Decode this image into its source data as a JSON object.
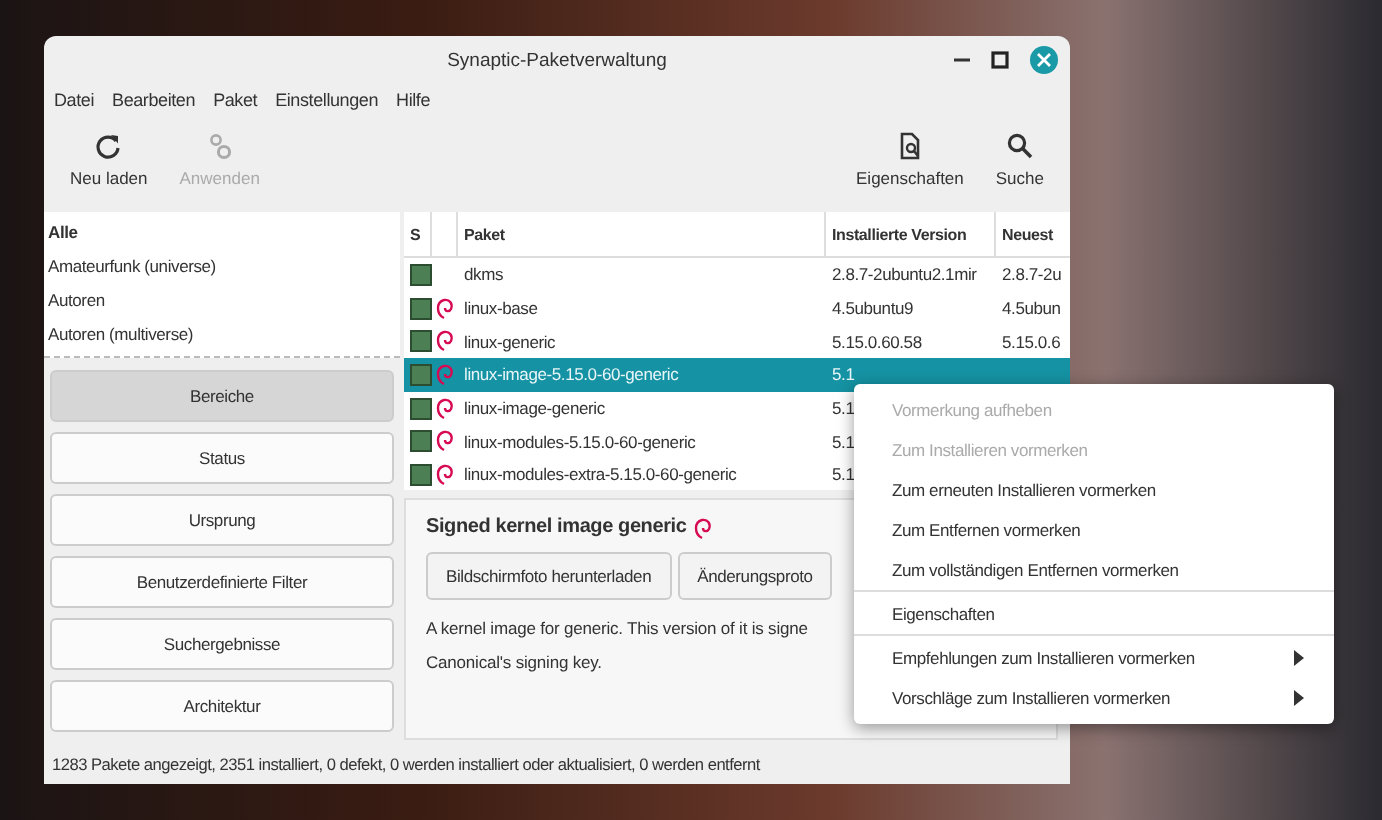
{
  "window": {
    "title": "Synaptic-Paketverwaltung"
  },
  "menu_bar": [
    "Datei",
    "Bearbeiten",
    "Paket",
    "Einstellungen",
    "Hilfe"
  ],
  "toolbar": [
    {
      "label": "Neu laden",
      "kind": "reload",
      "disabled": false
    },
    {
      "label": "Anwenden",
      "kind": "apply",
      "disabled": true
    },
    {
      "label": "Eigenschaften",
      "kind": "properties",
      "disabled": false
    },
    {
      "label": "Suche",
      "kind": "search",
      "disabled": false
    }
  ],
  "sections": [
    {
      "label": "Alle",
      "selected": true
    },
    {
      "label": "Amateurfunk (universe)",
      "selected": false
    },
    {
      "label": "Autoren",
      "selected": false
    },
    {
      "label": "Autoren (multiverse)",
      "selected": false
    }
  ],
  "filter_buttons": [
    {
      "label": "Bereiche",
      "selected": true
    },
    {
      "label": "Status",
      "selected": false
    },
    {
      "label": "Ursprung",
      "selected": false
    },
    {
      "label": "Benutzerdefinierte Filter",
      "selected": false
    },
    {
      "label": "Suchergebnisse",
      "selected": false
    },
    {
      "label": "Architektur",
      "selected": false
    }
  ],
  "table": {
    "columns": [
      "S",
      "Paket",
      "Installierte Version",
      "Neuest"
    ],
    "rows": [
      {
        "name": "dkms",
        "installed": "2.8.7-2ubuntu2.1mir",
        "newest": "2.8.7-2u",
        "supported": false,
        "selected": false
      },
      {
        "name": "linux-base",
        "installed": "4.5ubuntu9",
        "newest": "4.5ubun",
        "supported": true,
        "selected": false
      },
      {
        "name": "linux-generic",
        "installed": "5.15.0.60.58",
        "newest": "5.15.0.6",
        "supported": true,
        "selected": false
      },
      {
        "name": "linux-image-5.15.0-60-generic",
        "installed": "5.1",
        "newest": "",
        "supported": true,
        "selected": true
      },
      {
        "name": "linux-image-generic",
        "installed": "5.1",
        "newest": "",
        "supported": true,
        "selected": false
      },
      {
        "name": "linux-modules-5.15.0-60-generic",
        "installed": "5.1",
        "newest": "",
        "supported": true,
        "selected": false
      },
      {
        "name": "linux-modules-extra-5.15.0-60-generic",
        "installed": "5.1",
        "newest": "",
        "supported": true,
        "selected": false
      }
    ]
  },
  "details": {
    "title": "Signed kernel image generic",
    "buttons": [
      "Bildschirmfoto herunterladen",
      "Änderungsproto"
    ],
    "description": "A kernel image for generic.  This version of it is signe\nCanonical's signing key."
  },
  "status_bar": "1283 Pakete angezeigt, 2351 installiert, 0 defekt, 0 werden installiert oder aktualisiert, 0 werden entfernt",
  "context_menu": [
    {
      "label": "Vormerkung aufheben",
      "disabled": true,
      "submenu": false,
      "separator_after": false
    },
    {
      "label": "Zum Installieren vormerken",
      "disabled": true,
      "submenu": false,
      "separator_after": false
    },
    {
      "label": "Zum erneuten Installieren vormerken",
      "disabled": false,
      "submenu": false,
      "separator_after": false
    },
    {
      "label": "Zum Entfernen vormerken",
      "disabled": false,
      "submenu": false,
      "separator_after": false
    },
    {
      "label": "Zum vollständigen Entfernen vormerken",
      "disabled": false,
      "submenu": false,
      "separator_after": true
    },
    {
      "label": "Eigenschaften",
      "disabled": false,
      "submenu": false,
      "separator_after": true
    },
    {
      "label": "Empfehlungen zum Installieren vormerken",
      "disabled": false,
      "submenu": true,
      "separator_after": false
    },
    {
      "label": "Vorschläge zum Installieren vormerken",
      "disabled": false,
      "submenu": true,
      "separator_after": false
    }
  ]
}
